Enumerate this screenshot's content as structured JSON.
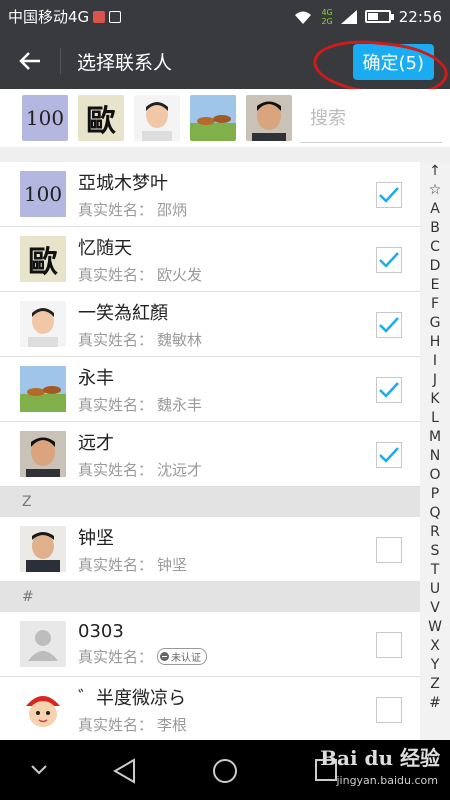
{
  "status_bar": {
    "carrier": "中国移动4G",
    "network_top": "4G",
    "network_bottom": "2G",
    "time": "22:56",
    "battery_level": 0.5
  },
  "header": {
    "title": "选择联系人",
    "confirm_label": "确定(5)"
  },
  "selected_strip": {
    "avatars": [
      {
        "kind": "text",
        "text": "100"
      },
      {
        "kind": "calligraphy",
        "text": "歐"
      },
      {
        "kind": "person"
      },
      {
        "kind": "horses"
      },
      {
        "kind": "person"
      }
    ],
    "search_placeholder": "搜索"
  },
  "contacts": [
    {
      "name": "亞城木梦叶",
      "real_name_label": "真实姓名：",
      "real_name": "邵炳",
      "checked": true,
      "avatar": "text"
    },
    {
      "name": "忆随天",
      "real_name_label": "真实姓名：",
      "real_name": "欧火发",
      "checked": true,
      "avatar": "calligraphy"
    },
    {
      "name": "一笑為紅顏",
      "real_name_label": "真实姓名：",
      "real_name": "魏敏林",
      "checked": true,
      "avatar": "person"
    },
    {
      "name": "永丰",
      "real_name_label": "真实姓名：",
      "real_name": "魏永丰",
      "checked": true,
      "avatar": "horses"
    },
    {
      "name": "远才",
      "real_name_label": "真实姓名：",
      "real_name": "沈远才",
      "checked": true,
      "avatar": "person"
    }
  ],
  "section_z": {
    "header": "Z",
    "contact": {
      "name": "钟坚",
      "real_name_label": "真实姓名：",
      "real_name": "钟坚",
      "checked": false,
      "avatar": "person"
    }
  },
  "section_hash": {
    "header": "#",
    "contacts": [
      {
        "name": "0303",
        "real_name_label": "真实姓名：",
        "badge": "未认证",
        "checked": false,
        "avatar": "placeholder"
      },
      {
        "name": "゛半度微凉ら",
        "real_name_label": "真实姓名：",
        "real_name": "李根",
        "checked": false,
        "avatar": "cartoon"
      }
    ]
  },
  "index_bar": [
    "↑",
    "☆",
    "A",
    "B",
    "C",
    "D",
    "E",
    "F",
    "G",
    "H",
    "I",
    "J",
    "K",
    "L",
    "M",
    "N",
    "O",
    "P",
    "Q",
    "R",
    "S",
    "T",
    "U",
    "V",
    "W",
    "X",
    "Y",
    "Z",
    "#"
  ],
  "watermark": {
    "logo": "Bai du 经验",
    "url": "jingyan.baidu.com"
  },
  "colors": {
    "header_bg": "#393a3e",
    "accent": "#1aacf3",
    "annotation": "#d11a1a"
  }
}
